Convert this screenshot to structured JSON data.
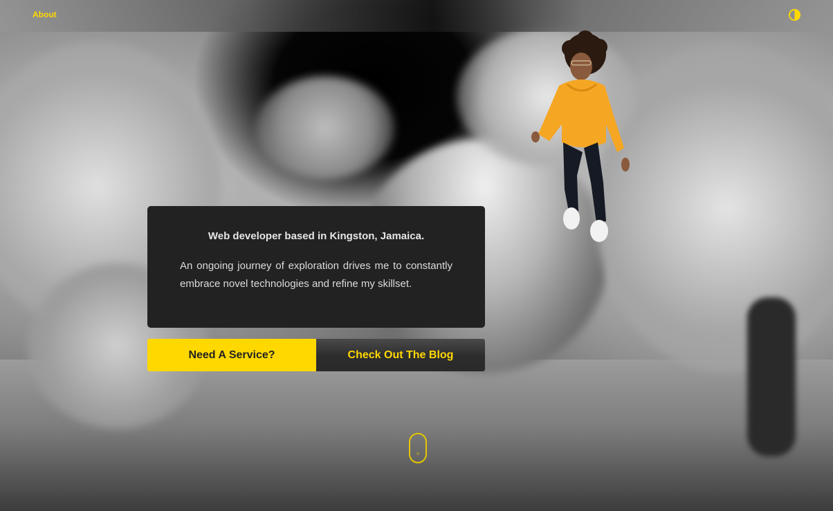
{
  "nav": {
    "about_label": "About",
    "theme_toggle_icon": "contrast-icon"
  },
  "hero": {
    "avatar_icon": "3d-avatar-figure",
    "card": {
      "title": "Web developer based in Kingston, Jamaica.",
      "body": "An ongoing journey of exploration drives me to constantly embrace novel technologies and refine my skillset."
    },
    "buttons": {
      "service_label": "Need A Service?",
      "blog_label": "Check Out The Blog"
    },
    "scroll_icon": "mouse-scroll-icon"
  },
  "colors": {
    "accent": "#ffd800",
    "card_bg": "#222222",
    "card_text": "#e6e6e6"
  }
}
